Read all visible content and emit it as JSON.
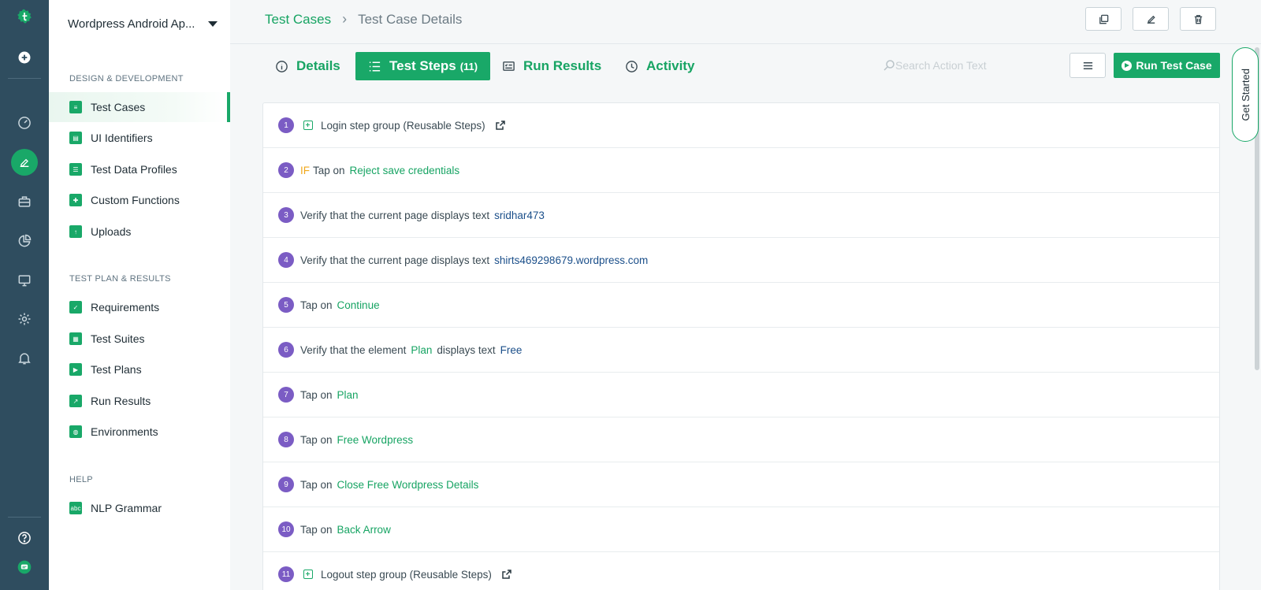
{
  "sidebar": {
    "project_name": "Wordpress Android Ap...",
    "sections": [
      {
        "title": "DESIGN & DEVELOPMENT"
      },
      {
        "title": "TEST PLAN & RESULTS"
      },
      {
        "title": "HELP"
      }
    ],
    "items": [
      {
        "label": "Test Cases",
        "icon": "test-cases-icon",
        "active": true
      },
      {
        "label": "UI Identifiers",
        "icon": "ui-identifiers-icon"
      },
      {
        "label": "Test Data Profiles",
        "icon": "test-data-icon"
      },
      {
        "label": "Custom Functions",
        "icon": "puzzle-icon"
      },
      {
        "label": "Uploads",
        "icon": "upload-icon"
      },
      {
        "label": "Requirements",
        "icon": "clipboard-icon"
      },
      {
        "label": "Test Suites",
        "icon": "suites-icon"
      },
      {
        "label": "Test Plans",
        "icon": "play-icon"
      },
      {
        "label": "Run Results",
        "icon": "results-icon"
      },
      {
        "label": "Environments",
        "icon": "globe-icon"
      },
      {
        "label": "NLP Grammar",
        "icon": "abc-icon"
      }
    ]
  },
  "breadcrumb": {
    "parent": "Test Cases",
    "current": "Test Case Details"
  },
  "tabs": [
    {
      "label": "Details",
      "icon": "info-icon"
    },
    {
      "label": "Test Steps",
      "count": "(11)",
      "icon": "list-icon",
      "active": true
    },
    {
      "label": "Run Results",
      "icon": "checklist-icon"
    },
    {
      "label": "Activity",
      "icon": "clock-icon"
    }
  ],
  "search": {
    "placeholder": "Search Action Text"
  },
  "run_button": "Run Test Case",
  "get_started": "Get Started",
  "steps": [
    {
      "n": "1",
      "group": true,
      "text": "Login step group (Reusable Steps)"
    },
    {
      "n": "2",
      "if": "IF",
      "pre": "Tap on",
      "el": "Reject save credentials"
    },
    {
      "n": "3",
      "pre": "Verify that the current page displays text",
      "tx": "sridhar473"
    },
    {
      "n": "4",
      "pre": "Verify that the current page displays text",
      "tx": "shirts469298679.wordpress.com"
    },
    {
      "n": "5",
      "pre": "Tap on",
      "el": "Continue"
    },
    {
      "n": "6",
      "pre": "Verify that the element",
      "el": "Plan",
      "mid": "displays text",
      "tx": "Free"
    },
    {
      "n": "7",
      "pre": "Tap on",
      "el": "Plan"
    },
    {
      "n": "8",
      "pre": "Tap on",
      "el": "Free Wordpress"
    },
    {
      "n": "9",
      "pre": "Tap on",
      "el": "Close Free Wordpress Details"
    },
    {
      "n": "10",
      "pre": "Tap on",
      "el": "Back Arrow"
    },
    {
      "n": "11",
      "group": true,
      "text": "Logout step group (Reusable Steps)"
    }
  ],
  "colors": {
    "accent": "#19a868",
    "rail": "#2f4d5f",
    "step_number": "#7b5cc4",
    "if_keyword": "#f0a81c",
    "text_value": "#1b4f8a"
  }
}
